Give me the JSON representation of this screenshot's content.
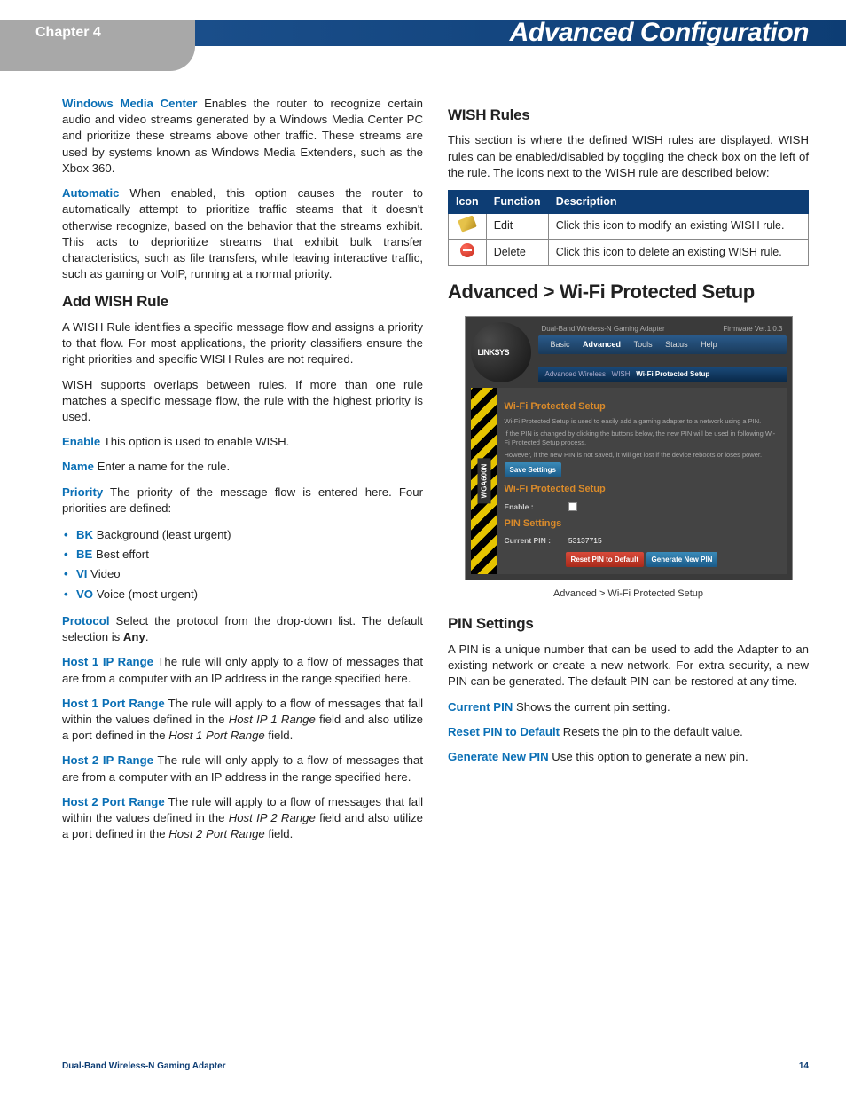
{
  "header": {
    "chapter": "Chapter 4",
    "title": "Advanced Configuration"
  },
  "left": {
    "wmc": {
      "label": "Windows Media Center",
      "text": "Enables the router to recognize certain audio and video streams generated by a Windows Media Center PC and prioritize these streams above other traffic. These streams are used by systems known as Windows Media Extenders, such as the Xbox 360."
    },
    "auto": {
      "label": "Automatic",
      "text": "When enabled, this option causes the router to automatically attempt to prioritize traffic steams that it doesn't otherwise recognize, based on the behavior that the streams exhibit. This acts to deprioritize streams that exhibit bulk transfer characteristics, such as file transfers, while leaving interactive traffic, such as gaming or VoIP, running at a normal priority."
    },
    "addRule": {
      "heading": "Add WISH Rule",
      "p1": "A WISH Rule identifies a specific message flow and assigns a priority to that flow. For most applications, the priority classifiers ensure the right priorities and specific WISH Rules are not required.",
      "p2": "WISH supports overlaps between rules. If more than one rule matches a specific message flow, the rule with the highest priority is used.",
      "enable": {
        "label": "Enable",
        "text": "This option is used to enable WISH."
      },
      "name": {
        "label": "Name",
        "text": "Enter a name for the rule."
      },
      "priority": {
        "label": "Priority",
        "text": "The priority of the message flow is entered here. Four priorities are defined:"
      },
      "priorities": [
        {
          "code": "BK",
          "text": "Background (least urgent)"
        },
        {
          "code": "BE",
          "text": "Best effort"
        },
        {
          "code": "VI",
          "text": "Video"
        },
        {
          "code": "VO",
          "text": "Voice (most urgent)"
        }
      ],
      "protocol": {
        "label": "Protocol",
        "text_a": "Select the protocol from the drop-down list. The default selection is ",
        "bold": "Any",
        "text_b": "."
      },
      "h1ip": {
        "label": "Host 1 IP Range",
        "text": "The rule will only apply to a flow of messages that are from a computer with an IP address in the range specified here."
      },
      "h1port": {
        "label": "Host 1 Port Range",
        "text_a": "The rule will apply to a flow of messages that fall within the values defined in the ",
        "em1": "Host IP 1 Range",
        "text_b": " field and also utilize a port defined in the ",
        "em2": "Host 1 Port Range",
        "text_c": " field."
      },
      "h2ip": {
        "label": "Host 2 IP Range",
        "text": "The rule will only apply to a flow of messages that are from a computer with an IP address in the range specified here."
      },
      "h2port": {
        "label": "Host 2 Port Range",
        "text_a": "The rule will apply to a flow of messages that fall within the values defined in the ",
        "em1": "Host IP 2 Range",
        "text_b": " field and also utilize a port defined in the ",
        "em2": "Host 2 Port Range",
        "text_c": " field."
      }
    }
  },
  "right": {
    "wishRules": {
      "heading": "WISH Rules",
      "p": "This section is where the defined WISH rules are displayed. WISH rules can be enabled/disabled by toggling the check box on the left of the rule. The icons next to the WISH rule are described below:",
      "table": {
        "headers": [
          "Icon",
          "Function",
          "Description"
        ],
        "rows": [
          {
            "icon": "edit",
            "func": "Edit",
            "desc": "Click this icon to modify an existing WISH rule."
          },
          {
            "icon": "delete",
            "func": "Delete",
            "desc": "Click this icon to delete an existing WISH rule."
          }
        ]
      }
    },
    "wps": {
      "heading": "Advanced > Wi-Fi Protected Setup",
      "caption": "Advanced > Wi-Fi Protected Setup",
      "screenshot": {
        "logo": "LINKSYS",
        "product": "Dual-Band Wireless-N Gaming Adapter",
        "firmware": "Firmware Ver.1.0.3",
        "tabs": {
          "basic": "Basic",
          "advanced": "Advanced",
          "tools": "Tools",
          "status": "Status",
          "help": "Help"
        },
        "subtabs": {
          "a": "Advanced Wireless",
          "b": "WISH",
          "c": "Wi-Fi Protected Setup"
        },
        "sideModel": "WGA600N",
        "sec1_title": "Wi-Fi Protected Setup",
        "desc1": "Wi-Fi Protected Setup is used to easily add a gaming adapter to a network using a PIN.",
        "desc2": "If the PIN is changed by clicking the buttons below, the new PIN will be used in following Wi-Fi Protected Setup process.",
        "desc3": "However, if the new PIN is not saved, it will get lost if the device reboots or loses power.",
        "saveBtn": "Save Settings",
        "sec2_title": "Wi-Fi Protected Setup",
        "enableLabel": "Enable :",
        "sec3_title": "PIN Settings",
        "pinLabel": "Current PIN :",
        "pinValue": "53137715",
        "resetBtn": "Reset PIN to Default",
        "genBtn": "Generate New PIN"
      }
    },
    "pin": {
      "heading": "PIN Settings",
      "p": "A PIN is a unique number that can be used to add the Adapter to an existing network or create a new network. For extra security, a new PIN can be generated.  The default PIN can be restored at any time.",
      "current": {
        "label": "Current PIN",
        "text": "Shows the current pin setting."
      },
      "reset": {
        "label": "Reset PIN to Default",
        "text": "Resets the pin to the default value."
      },
      "gen": {
        "label": "Generate New PIN",
        "text": "Use this option to generate a new pin."
      }
    }
  },
  "footer": {
    "product": "Dual-Band Wireless-N Gaming Adapter",
    "page": "14"
  }
}
